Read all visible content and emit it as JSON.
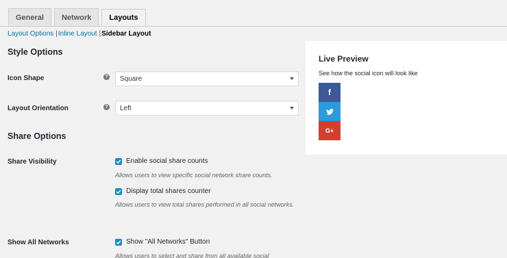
{
  "tabs": [
    {
      "label": "General"
    },
    {
      "label": "Network"
    },
    {
      "label": "Layouts"
    }
  ],
  "subnav": {
    "items": [
      "Layout Options",
      "Inline Layout",
      "Sidebar Layout"
    ],
    "separator": "|"
  },
  "style_options": {
    "heading": "Style Options",
    "icon_shape": {
      "label": "Icon Shape",
      "value": "Square"
    },
    "layout_orientation": {
      "label": "Layout Orientation",
      "value": "Left"
    }
  },
  "share_options": {
    "heading": "Share Options",
    "share_visibility": {
      "label": "Share Visibility",
      "enable_counts": {
        "label": "Enable social share counts",
        "checked": true,
        "description": "Allows users to view specific social network share counts."
      },
      "total_counter": {
        "label": "Display total shares counter",
        "checked": true,
        "description": "Allows users to view total shares performed in all social networks."
      }
    },
    "show_all_networks": {
      "label": "Show All Networks",
      "button_option": {
        "label": "Show \"All Networks\" Button",
        "checked": true,
        "description": "Allows users to select and share from all available social"
      }
    }
  },
  "live_preview": {
    "title": "Live Preview",
    "description": "See how the social icon will look like",
    "icons": [
      {
        "name": "facebook-icon",
        "glyph": "f",
        "color": "#3b5998"
      },
      {
        "name": "twitter-icon",
        "glyph": "",
        "color": "#2d9ad9"
      },
      {
        "name": "google-plus-icon",
        "glyph": "G+",
        "color": "#d23f31"
      }
    ]
  },
  "help_glyph": "?"
}
